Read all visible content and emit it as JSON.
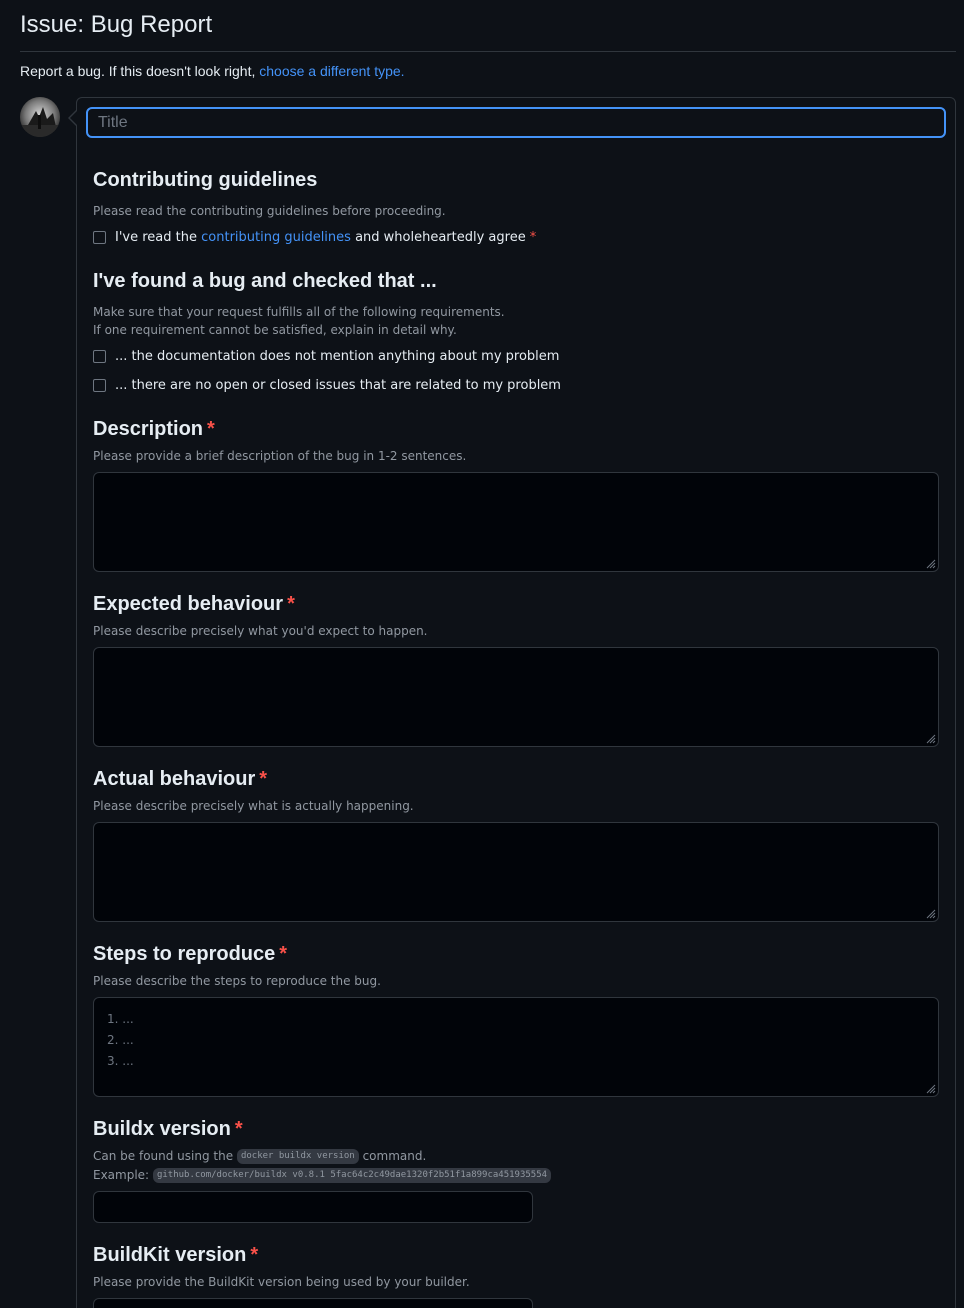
{
  "page": {
    "heading": "Issue: Bug Report",
    "subtitle_text": "Report a bug. If this doesn't look right,",
    "subtitle_link": "choose a different type."
  },
  "title_field": {
    "placeholder": "Title",
    "value": ""
  },
  "sections": {
    "contributing": {
      "heading": "Contributing guidelines",
      "help": "Please read the contributing guidelines before proceeding.",
      "check_prefix": "I've read the",
      "check_link": "contributing guidelines",
      "check_suffix": "and wholeheartedly agree",
      "required_mark": "*",
      "checked": false
    },
    "checked_that": {
      "heading": "I've found a bug and checked that ...",
      "help_line1": "Make sure that your request fulfills all of the following requirements.",
      "help_line2": "If one requirement cannot be satisfied, explain in detail why.",
      "items": [
        {
          "label": "... the documentation does not mention anything about my problem",
          "checked": false
        },
        {
          "label": "... there are no open or closed issues that are related to my problem",
          "checked": false
        }
      ]
    },
    "description": {
      "heading": "Description",
      "required_mark": "*",
      "help": "Please provide a brief description of the bug in 1-2 sentences.",
      "value": ""
    },
    "expected": {
      "heading": "Expected behaviour",
      "required_mark": "*",
      "help": "Please describe precisely what you'd expect to happen.",
      "value": ""
    },
    "actual": {
      "heading": "Actual behaviour",
      "required_mark": "*",
      "help": "Please describe precisely what is actually happening.",
      "value": ""
    },
    "steps": {
      "heading": "Steps to reproduce",
      "required_mark": "*",
      "help": "Please describe the steps to reproduce the bug.",
      "placeholder_lines": [
        "1. ...",
        "2. ...",
        "3. ..."
      ]
    },
    "buildx": {
      "heading": "Buildx version",
      "required_mark": "*",
      "help_prefix": "Can be found using the",
      "help_code": "docker buildx version",
      "help_suffix": "command.",
      "example_label": "Example:",
      "example_code": "github.com/docker/buildx v0.8.1 5fac64c2c49dae1320f2b51f1a899ca451935554",
      "value": ""
    },
    "buildkit": {
      "heading": "BuildKit version",
      "required_mark": "*",
      "help": "Please provide the BuildKit version being used by your builder.",
      "value": ""
    }
  },
  "colors": {
    "background": "#0d1117",
    "border": "#30363d",
    "link": "#4493f8",
    "required": "#f85149",
    "muted": "#9198a1"
  }
}
